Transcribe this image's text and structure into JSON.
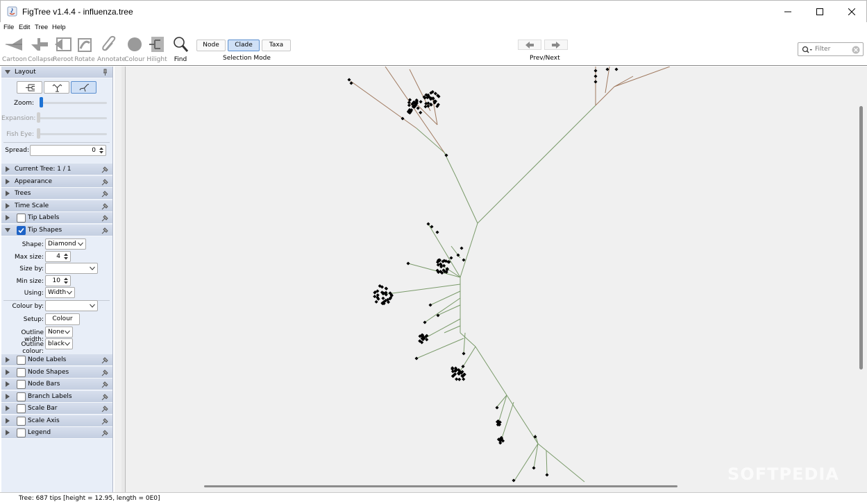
{
  "window": {
    "title": "FigTree v1.4.4 - influenza.tree"
  },
  "menu": [
    "File",
    "Edit",
    "Tree",
    "Help"
  ],
  "toolbar": {
    "tools": [
      {
        "label": "Cartoon",
        "icon": "cartoon-icon",
        "enabled": false
      },
      {
        "label": "Collapse",
        "icon": "collapse-icon",
        "enabled": false
      },
      {
        "label": "Reroot",
        "icon": "reroot-icon",
        "enabled": false
      },
      {
        "label": "Rotate",
        "icon": "rotate-icon",
        "enabled": false
      },
      {
        "label": "Annotate",
        "icon": "paperclip-icon",
        "enabled": false
      },
      {
        "label": "Colour",
        "icon": "colour-icon",
        "enabled": false
      },
      {
        "label": "Hilight",
        "icon": "hilight-icon",
        "enabled": false
      },
      {
        "label": "Find",
        "icon": "magnifier-icon",
        "enabled": true
      }
    ],
    "selection_modes": [
      "Node",
      "Clade",
      "Taxa"
    ],
    "selected_mode": "Clade",
    "selection_caption": "Selection Mode",
    "prevnext_caption": "Prev/Next",
    "filter_placeholder": "Filter"
  },
  "panel": {
    "layout": {
      "title": "Layout",
      "zoom_label": "Zoom:",
      "expansion_label": "Expansion:",
      "fisheye_label": "Fish Eye:",
      "spread_label": "Spread:",
      "spread_value": "0"
    },
    "sections": {
      "current_tree": "Current Tree: 1 / 1",
      "appearance": "Appearance",
      "trees": "Trees",
      "time_scale": "Time Scale",
      "tip_labels": "Tip Labels",
      "tip_shapes": "Tip Shapes"
    },
    "tip_shapes": {
      "shape_label": "Shape:",
      "shape_value": "Diamond",
      "max_size_label": "Max size:",
      "max_size_value": "4",
      "size_by_label": "Size by:",
      "size_by_value": "",
      "min_size_label": "Min size:",
      "min_size_value": "10",
      "using_label": "Using:",
      "using_value": "Width",
      "colour_by_label": "Colour by:",
      "colour_by_value": "",
      "setup_label": "Setup:",
      "setup_button": "Colour",
      "outline_width_label": "Outline width:",
      "outline_width_value": "None",
      "outline_colour_label": "Outline colour:",
      "outline_colour_value": "black"
    },
    "more_sections": {
      "node_labels": "Node Labels",
      "node_shapes": "Node Shapes",
      "node_bars": "Node Bars",
      "branch_labels": "Branch Labels",
      "scale_bar": "Scale Bar",
      "scale_axis": "Scale Axis",
      "legend": "Legend"
    }
  },
  "status": "Tree: 687 tips [height = 12.95, length = 0E0]",
  "watermark": "SOFTPEDIA",
  "colors": {
    "branch_green": "#7a9a6a",
    "branch_brown": "#a07a60",
    "tip": "#000000",
    "accent": "#1e63c6"
  }
}
